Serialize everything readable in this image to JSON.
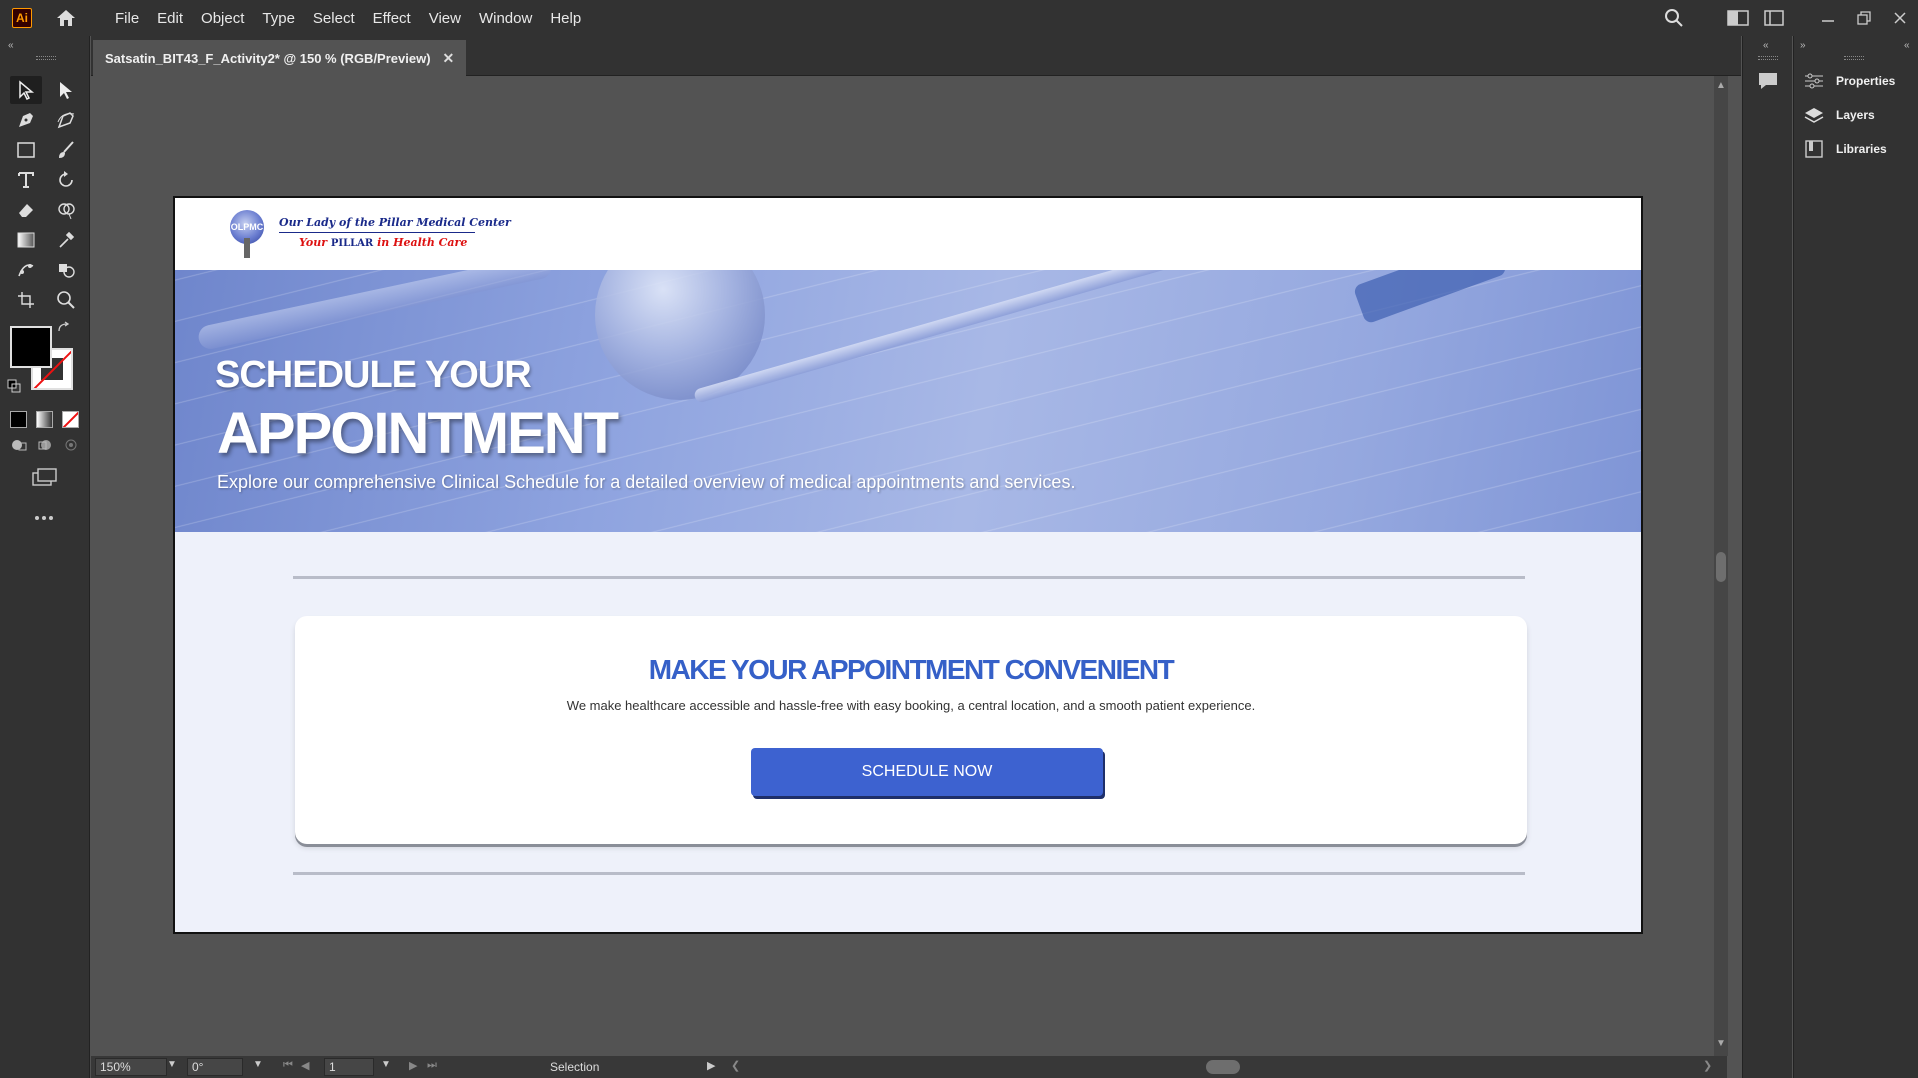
{
  "app": {
    "logo_text": "Ai"
  },
  "menu": [
    "File",
    "Edit",
    "Object",
    "Type",
    "Select",
    "Effect",
    "View",
    "Window",
    "Help"
  ],
  "document": {
    "tab_title": "Satsatin_BIT43_F_Activity2* @ 150 % (RGB/Preview)",
    "close_glyph": "✕"
  },
  "site": {
    "logo_initials": "OLPMC",
    "logo_name": "Our Lady of the Pillar Medical Center",
    "tagline_pre": "Your",
    "tagline_pillar": "PILLAR",
    "tagline_post": "in Health Care",
    "hero_line1": "SCHEDULE YOUR",
    "hero_title": "APPOINTMENT",
    "hero_description": "Explore our comprehensive Clinical Schedule for a detailed overview of medical appointments and services.",
    "card_title": "MAKE YOUR APPOINTMENT CONVENIENT",
    "card_text": "We make healthcare accessible and hassle-free with easy booking, a central location, and a smooth patient experience.",
    "cta_label": "SCHEDULE NOW",
    "colors": {
      "accent": "#3d62d0",
      "title_blue": "#3560c8",
      "content_bg": "#eef1fa"
    }
  },
  "statusbar": {
    "zoom": "150%",
    "rotation": "0°",
    "artboard": "1",
    "tool": "Selection"
  },
  "panels": [
    "Properties",
    "Layers",
    "Libraries"
  ],
  "icons": [
    "home-icon",
    "search-icon",
    "arrange-documents-icon",
    "workspace-icon",
    "minimize-icon",
    "restore-icon",
    "close-icon",
    "comments-icon",
    "properties-icon",
    "layers-icon",
    "libraries-icon"
  ]
}
